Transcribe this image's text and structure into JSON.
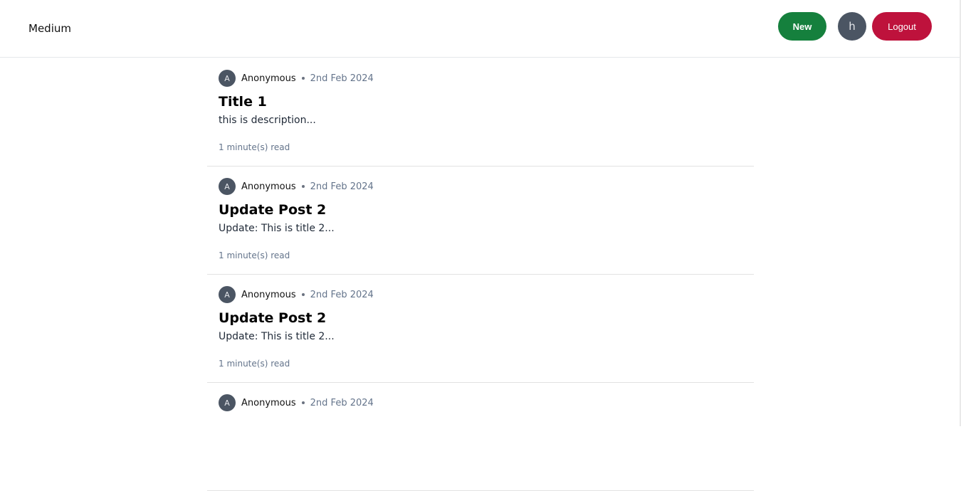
{
  "header": {
    "brand": "Medium",
    "new_label": "New",
    "user_initial": "h",
    "logout_label": "Logout"
  },
  "posts": [
    {
      "author_initial": "A",
      "author": "Anonymous",
      "date": "2nd Feb 2024",
      "title": "Title 1",
      "description": "this is description...",
      "read_time": "1 minute(s) read"
    },
    {
      "author_initial": "A",
      "author": "Anonymous",
      "date": "2nd Feb 2024",
      "title": "Update Post 2",
      "description": "Update: This is title 2...",
      "read_time": "1 minute(s) read"
    },
    {
      "author_initial": "A",
      "author": "Anonymous",
      "date": "2nd Feb 2024",
      "title": "Update Post 2",
      "description": "Update: This is title 2...",
      "read_time": "1 minute(s) read"
    },
    {
      "author_initial": "A",
      "author": "Anonymous",
      "date": "2nd Feb 2024"
    }
  ],
  "colors": {
    "new_button": "#15803d",
    "logout_button": "#be123c",
    "avatar": "#4b5563"
  }
}
